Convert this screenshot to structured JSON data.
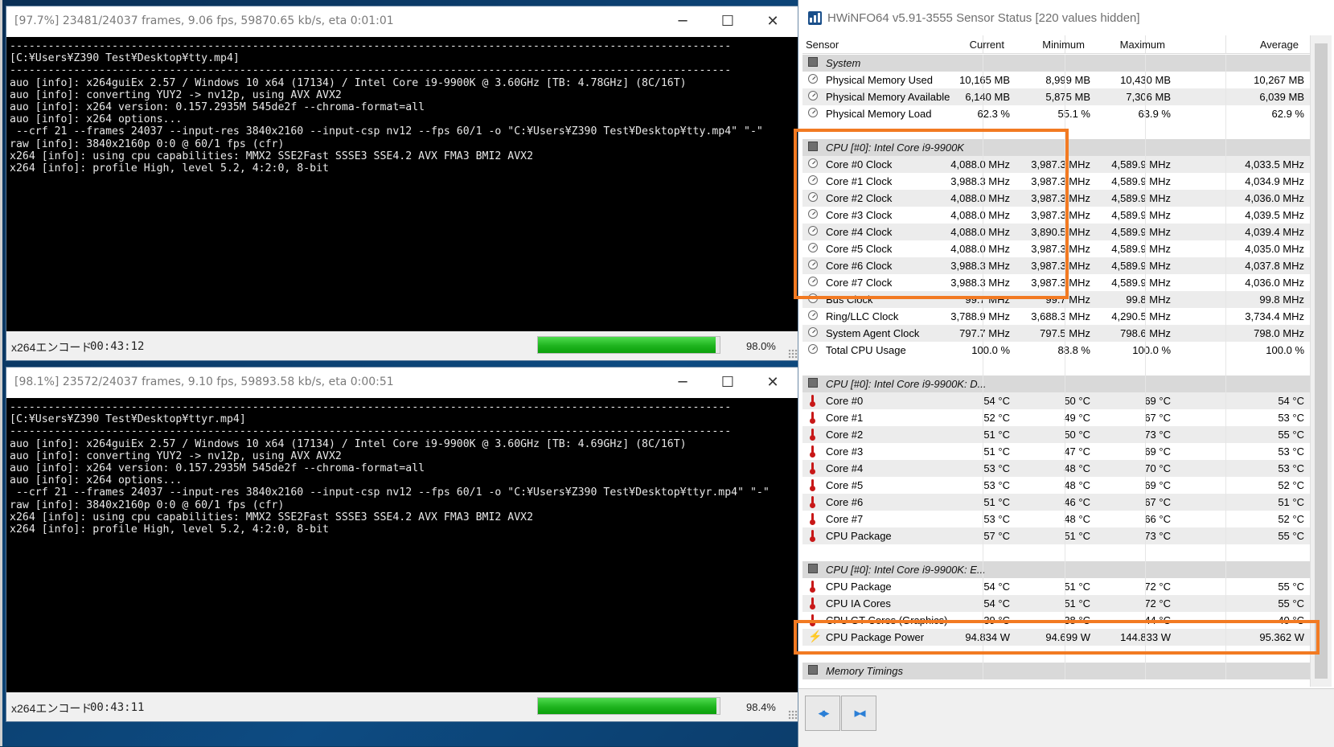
{
  "desktop": {
    "accent": "#f27a22"
  },
  "console1": {
    "title": "[97.7%] 23481/24037 frames, 9.06 fps, 59870.65 kb/s, eta 0:01:01",
    "lines": [
      "-----------------------------------------------------------------------------------------------------------------",
      "[C:¥Users¥Z390 Test¥Desktop¥tty.mp4]",
      "-----------------------------------------------------------------------------------------------------------------",
      "auo [info]: x264guiEx 2.57 / Windows 10 x64 (17134) / Intel Core i9-9900K @ 3.60GHz [TB: 4.78GHz] (8C/16T)",
      "auo [info]: converting YUY2 -> nv12p, using AVX AVX2",
      "auo [info]: x264 version: 0.157.2935M 545de2f --chroma-format=all",
      "auo [info]: x264 options...",
      " --crf 21 --frames 24037 --input-res 3840x2160 --input-csp nv12 --fps 60/1 -o \"C:¥Users¥Z390 Test¥Desktop¥tty.mp4\" \"-\"",
      "raw [info]: 3840x2160p 0:0 @ 60/1 fps (cfr)",
      "x264 [info]: using cpu capabilities: MMX2 SSE2Fast SSSE3 SSE4.2 AVX FMA3 BMI2 AVX2",
      "x264 [info]: profile High, level 5.2, 4:2:0, 8-bit"
    ],
    "status_name": "x264エンコード",
    "status_time": "00:43:12",
    "progress": 0.977,
    "progress_label": "98.0%"
  },
  "console2": {
    "title": "[98.1%] 23572/24037 frames, 9.10 fps, 59893.58 kb/s, eta 0:00:51",
    "lines": [
      "-----------------------------------------------------------------------------------------------------------------",
      "[C:¥Users¥Z390 Test¥Desktop¥ttyr.mp4]",
      "-----------------------------------------------------------------------------------------------------------------",
      "auo [info]: x264guiEx 2.57 / Windows 10 x64 (17134) / Intel Core i9-9900K @ 3.60GHz [TB: 4.69GHz] (8C/16T)",
      "auo [info]: converting YUY2 -> nv12p, using AVX AVX2",
      "auo [info]: x264 version: 0.157.2935M 545de2f --chroma-format=all",
      "auo [info]: x264 options...",
      " --crf 21 --frames 24037 --input-res 3840x2160 --input-csp nv12 --fps 60/1 -o \"C:¥Users¥Z390 Test¥Desktop¥ttyr.mp4\" \"-\"",
      "raw [info]: 3840x2160p 0:0 @ 60/1 fps (cfr)",
      "x264 [info]: using cpu capabilities: MMX2 SSE2Fast SSSE3 SSE4.2 AVX FMA3 BMI2 AVX2",
      "x264 [info]: profile High, level 5.2, 4:2:0, 8-bit"
    ],
    "status_name": "x264エンコード",
    "status_time": "00:43:11",
    "progress": 0.981,
    "progress_label": "98.4%"
  },
  "hwinfo": {
    "title": "HWiNFO64 v5.91-3555 Sensor Status [220 values hidden]",
    "columns": [
      "Sensor",
      "Current",
      "Minimum",
      "Maximum",
      "Average"
    ],
    "rows": [
      {
        "type": "group",
        "label": "System"
      },
      {
        "icon": "clock",
        "label": "Physical Memory Used",
        "v": [
          "10,165 MB",
          "8,999 MB",
          "10,430 MB",
          "10,267 MB"
        ]
      },
      {
        "icon": "clock",
        "label": "Physical Memory Available",
        "v": [
          "6,140 MB",
          "5,875 MB",
          "7,306 MB",
          "6,039 MB"
        ]
      },
      {
        "icon": "clock",
        "label": "Physical Memory Load",
        "v": [
          "62.3 %",
          "55.1 %",
          "63.9 %",
          "62.9 %"
        ]
      },
      {
        "type": "blank"
      },
      {
        "type": "group",
        "label": "CPU [#0]: Intel Core i9-9900K"
      },
      {
        "icon": "clock",
        "label": "Core #0 Clock",
        "v": [
          "4,088.0 MHz",
          "3,987.3 MHz",
          "4,589.9 MHz",
          "4,033.5 MHz"
        ]
      },
      {
        "icon": "clock",
        "label": "Core #1 Clock",
        "v": [
          "3,988.3 MHz",
          "3,987.3 MHz",
          "4,589.9 MHz",
          "4,034.9 MHz"
        ]
      },
      {
        "icon": "clock",
        "label": "Core #2 Clock",
        "v": [
          "4,088.0 MHz",
          "3,987.3 MHz",
          "4,589.9 MHz",
          "4,036.0 MHz"
        ]
      },
      {
        "icon": "clock",
        "label": "Core #3 Clock",
        "v": [
          "4,088.0 MHz",
          "3,987.3 MHz",
          "4,589.9 MHz",
          "4,039.5 MHz"
        ]
      },
      {
        "icon": "clock",
        "label": "Core #4 Clock",
        "v": [
          "4,088.0 MHz",
          "3,890.5 MHz",
          "4,589.9 MHz",
          "4,039.4 MHz"
        ]
      },
      {
        "icon": "clock",
        "label": "Core #5 Clock",
        "v": [
          "4,088.0 MHz",
          "3,987.3 MHz",
          "4,589.9 MHz",
          "4,035.0 MHz"
        ]
      },
      {
        "icon": "clock",
        "label": "Core #6 Clock",
        "v": [
          "3,988.3 MHz",
          "3,987.3 MHz",
          "4,589.9 MHz",
          "4,037.8 MHz"
        ]
      },
      {
        "icon": "clock",
        "label": "Core #7 Clock",
        "v": [
          "3,988.3 MHz",
          "3,987.3 MHz",
          "4,589.9 MHz",
          "4,036.0 MHz"
        ]
      },
      {
        "icon": "clock",
        "label": "Bus Clock",
        "v": [
          "99.7 MHz",
          "99.7 MHz",
          "99.8 MHz",
          "99.8 MHz"
        ]
      },
      {
        "icon": "clock",
        "label": "Ring/LLC Clock",
        "v": [
          "3,788.9 MHz",
          "3,688.3 MHz",
          "4,290.5 MHz",
          "3,734.4 MHz"
        ]
      },
      {
        "icon": "clock",
        "label": "System Agent Clock",
        "v": [
          "797.7 MHz",
          "797.5 MHz",
          "798.6 MHz",
          "798.0 MHz"
        ]
      },
      {
        "icon": "clock",
        "label": "Total CPU Usage",
        "v": [
          "100.0 %",
          "88.8 %",
          "100.0 %",
          "100.0 %"
        ]
      },
      {
        "type": "blank"
      },
      {
        "type": "group",
        "label": "CPU [#0]: Intel Core i9-9900K: D..."
      },
      {
        "icon": "temp",
        "label": "Core #0",
        "v": [
          "54 °C",
          "50 °C",
          "69 °C",
          "54 °C"
        ]
      },
      {
        "icon": "temp",
        "label": "Core #1",
        "v": [
          "52 °C",
          "49 °C",
          "67 °C",
          "53 °C"
        ]
      },
      {
        "icon": "temp",
        "label": "Core #2",
        "v": [
          "51 °C",
          "50 °C",
          "73 °C",
          "55 °C"
        ]
      },
      {
        "icon": "temp",
        "label": "Core #3",
        "v": [
          "51 °C",
          "47 °C",
          "69 °C",
          "53 °C"
        ]
      },
      {
        "icon": "temp",
        "label": "Core #4",
        "v": [
          "53 °C",
          "48 °C",
          "70 °C",
          "53 °C"
        ]
      },
      {
        "icon": "temp",
        "label": "Core #5",
        "v": [
          "53 °C",
          "48 °C",
          "69 °C",
          "52 °C"
        ]
      },
      {
        "icon": "temp",
        "label": "Core #6",
        "v": [
          "51 °C",
          "46 °C",
          "67 °C",
          "51 °C"
        ]
      },
      {
        "icon": "temp",
        "label": "Core #7",
        "v": [
          "53 °C",
          "48 °C",
          "66 °C",
          "52 °C"
        ]
      },
      {
        "icon": "temp",
        "label": "CPU Package",
        "v": [
          "57 °C",
          "51 °C",
          "73 °C",
          "55 °C"
        ]
      },
      {
        "type": "blank"
      },
      {
        "type": "group",
        "label": "CPU [#0]: Intel Core i9-9900K: E..."
      },
      {
        "icon": "temp",
        "label": "CPU Package",
        "v": [
          "54 °C",
          "51 °C",
          "72 °C",
          "55 °C"
        ]
      },
      {
        "icon": "temp",
        "label": "CPU IA Cores",
        "v": [
          "54 °C",
          "51 °C",
          "72 °C",
          "55 °C"
        ]
      },
      {
        "icon": "temp",
        "label": "CPU GT Cores (Graphics)",
        "v": [
          "39 °C",
          "38 °C",
          "44 °C",
          "40 °C"
        ]
      },
      {
        "icon": "power",
        "label": "CPU Package Power",
        "v": [
          "94.834 W",
          "94.699 W",
          "144.833 W",
          "95.362 W"
        ]
      },
      {
        "type": "blank"
      },
      {
        "type": "group",
        "label": "Memory Timings"
      }
    ],
    "nav_prev": "◂▸",
    "nav_next": "▸◂"
  }
}
